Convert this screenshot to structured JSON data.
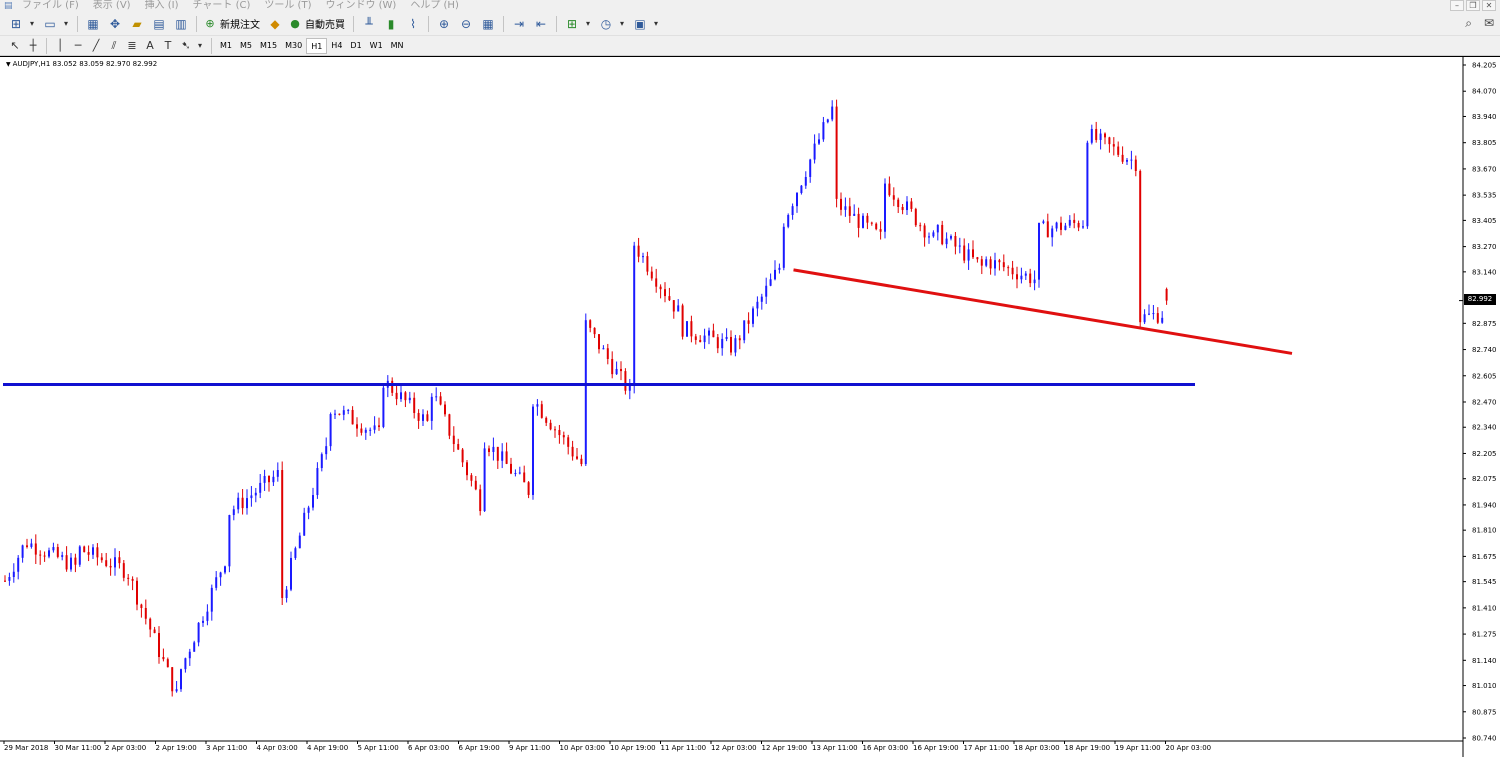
{
  "menu": {
    "items": [
      "ファイル (F)",
      "表示 (V)",
      "挿入 (I)",
      "チャート (C)",
      "ツール (T)",
      "ウィンドウ (W)",
      "ヘルプ (H)"
    ]
  },
  "toolbar": {
    "new_order_label": "新規注文",
    "auto_trading_label": "自動売買",
    "timeframes": [
      "M1",
      "M5",
      "M15",
      "M30",
      "H1",
      "H4",
      "D1",
      "W1",
      "MN"
    ],
    "active_timeframe": "H1"
  },
  "chart": {
    "symbol_info": "AUDJPY,H1  83.052 83.059 82.970 82.992",
    "current_price": "82.992",
    "price_labels": [
      "84.205",
      "84.070",
      "83.940",
      "83.805",
      "83.670",
      "83.535",
      "83.405",
      "83.270",
      "83.140",
      "82.875",
      "82.740",
      "82.605",
      "82.470",
      "82.340",
      "82.205",
      "82.075",
      "81.940",
      "81.810",
      "81.675",
      "81.545",
      "81.410",
      "81.275",
      "81.140",
      "81.010",
      "80.875",
      "80.740"
    ],
    "time_labels": [
      "29 Mar 2018",
      "30 Mar 11:00",
      "2 Apr 03:00",
      "2 Apr 19:00",
      "3 Apr 11:00",
      "4 Apr 03:00",
      "4 Apr 19:00",
      "5 Apr 11:00",
      "6 Apr 03:00",
      "6 Apr 19:00",
      "9 Apr 11:00",
      "10 Apr 03:00",
      "10 Apr 19:00",
      "11 Apr 11:00",
      "12 Apr 03:00",
      "12 Apr 19:00",
      "13 Apr 11:00",
      "16 Apr 03:00",
      "16 Apr 19:00",
      "17 Apr 11:00",
      "18 Apr 03:00",
      "18 Apr 19:00",
      "19 Apr 11:00",
      "20 Apr 03:00"
    ],
    "colors": {
      "bull": "#1a1aff",
      "bear": "#e00000",
      "hline": "#1010d0",
      "trendline": "#e01010"
    },
    "horizontal_line_price": 82.56,
    "trendline": {
      "start_price": 83.15,
      "end_price": 82.72,
      "start_time": "12 Apr 19:00",
      "end_time": "20 Apr 03:00"
    }
  },
  "chart_data": {
    "type": "candlestick",
    "symbol": "AUDJPY",
    "timeframe": "H1",
    "ylim": [
      80.74,
      84.205
    ],
    "close_path": [
      [
        "29 Mar 2018",
        81.55
      ],
      [
        "29 Mar 2018",
        81.75
      ],
      [
        "30 Mar 11:00",
        81.62
      ],
      [
        "30 Mar 11:00",
        81.72
      ],
      [
        "2 Apr 03:00",
        81.6
      ],
      [
        "2 Apr 19:00",
        80.95
      ],
      [
        "2 Apr 19:00",
        81.05
      ],
      [
        "3 Apr 11:00",
        81.7
      ],
      [
        "3 Apr 11:00",
        81.9
      ],
      [
        "4 Apr 03:00",
        82.1
      ],
      [
        "4 Apr 03:00",
        81.4
      ],
      [
        "4 Apr 19:00",
        82.3
      ],
      [
        "4 Apr 19:00",
        82.45
      ],
      [
        "5 Apr 11:00",
        82.3
      ],
      [
        "5 Apr 11:00",
        82.6
      ],
      [
        "6 Apr 03:00",
        82.35
      ],
      [
        "6 Apr 03:00",
        82.55
      ],
      [
        "6 Apr 19:00",
        81.95
      ],
      [
        "6 Apr 19:00",
        82.3
      ],
      [
        "9 Apr 11:00",
        82.0
      ],
      [
        "9 Apr 11:00",
        82.5
      ],
      [
        "10 Apr 03:00",
        82.15
      ],
      [
        "10 Apr 03:00",
        82.9
      ],
      [
        "10 Apr 19:00",
        82.5
      ],
      [
        "10 Apr 19:00",
        83.3
      ],
      [
        "11 Apr 11:00",
        82.9
      ],
      [
        "11 Apr 11:00",
        82.85
      ],
      [
        "12 Apr 03:00",
        82.75
      ],
      [
        "12 Apr 19:00",
        83.2
      ],
      [
        "12 Apr 19:00",
        83.4
      ],
      [
        "13 Apr 11:00",
        84.0
      ],
      [
        "13 Apr 11:00",
        83.5
      ],
      [
        "16 Apr 03:00",
        83.3
      ],
      [
        "16 Apr 03:00",
        83.6
      ],
      [
        "16 Apr 19:00",
        83.3
      ],
      [
        "16 Apr 19:00",
        83.35
      ],
      [
        "17 Apr 11:00",
        83.15
      ],
      [
        "17 Apr 11:00",
        83.2
      ],
      [
        "18 Apr 03:00",
        83.1
      ],
      [
        "18 Apr 03:00",
        83.35
      ],
      [
        "18 Apr 19:00",
        83.4
      ],
      [
        "18 Apr 19:00",
        83.85
      ],
      [
        "19 Apr 11:00",
        83.7
      ],
      [
        "19 Apr 11:00",
        83.4
      ],
      [
        "19 Apr 11:00",
        82.9
      ],
      [
        "20 Apr 03:00",
        82.95
      ],
      [
        "20 Apr 03:00",
        83.0
      ]
    ],
    "last": {
      "open": 83.052,
      "high": 83.059,
      "low": 82.97,
      "close": 82.992
    },
    "horizontal_level": 82.56,
    "trendline": [
      [
        "12 Apr 19:00",
        83.15
      ],
      [
        "20 Apr 03:00",
        82.72
      ]
    ]
  }
}
